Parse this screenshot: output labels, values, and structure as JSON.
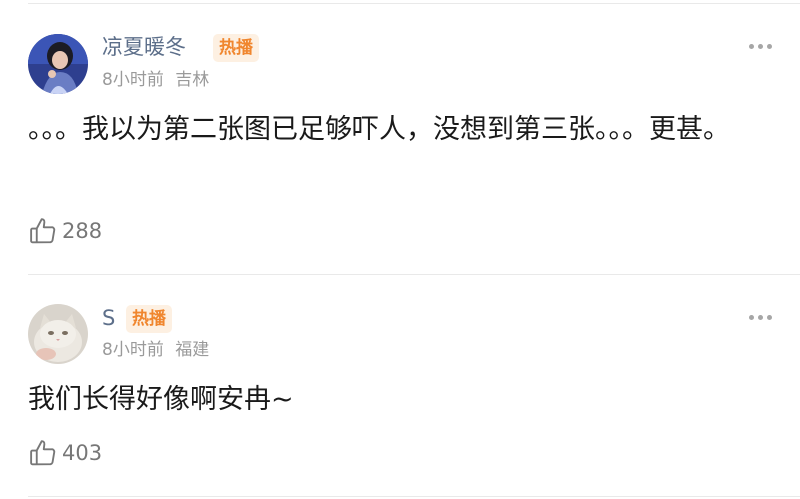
{
  "comments": [
    {
      "username": "凉夏暖冬",
      "badge": "热播",
      "time": "8小时前",
      "location": "吉林",
      "text": "。。。我以为第二张图已足够吓人，没想到第三张。。。更甚。",
      "likes": "288",
      "avatar_icon": "girl-portrait-avatar"
    },
    {
      "username": "S",
      "badge": "热播",
      "time": "8小时前",
      "location": "福建",
      "text": "我们长得好像啊安冉~",
      "likes": "403",
      "avatar_icon": "cat-photo-avatar"
    }
  ],
  "colors": {
    "username": "#5d6f8a",
    "badge_text": "#f0862e",
    "badge_bg": "#fdf0e2",
    "meta": "#9a9a9a"
  }
}
